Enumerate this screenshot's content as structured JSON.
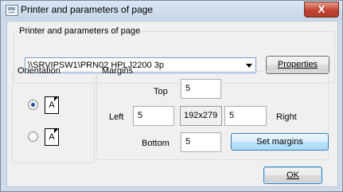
{
  "window": {
    "title": "Printer and parameters of page",
    "close_label": "X"
  },
  "printer_group": {
    "legend": "Printer and parameters of page",
    "selected_printer": "\\\\SRVIPSW1\\PRN02 HPLJ2200 3p",
    "properties_label": "Properties"
  },
  "orientation": {
    "legend": "Orientation",
    "portrait_selected": true,
    "portrait_glyph": "A",
    "landscape_glyph": "A"
  },
  "margins": {
    "legend": "Margins",
    "top_label": "Top",
    "left_label": "Left",
    "right_label": "Right",
    "bottom_label": "Bottom",
    "top_value": "5",
    "left_value": "5",
    "right_value": "5",
    "bottom_value": "5",
    "page_size": "192x279",
    "set_margins_label": "Set margins"
  },
  "footer": {
    "ok_label": "OK"
  },
  "colors": {
    "frame": "#cfdbe9",
    "client": "#f0f0f0",
    "close": "#c24433",
    "focus": "#3c7fb1"
  }
}
